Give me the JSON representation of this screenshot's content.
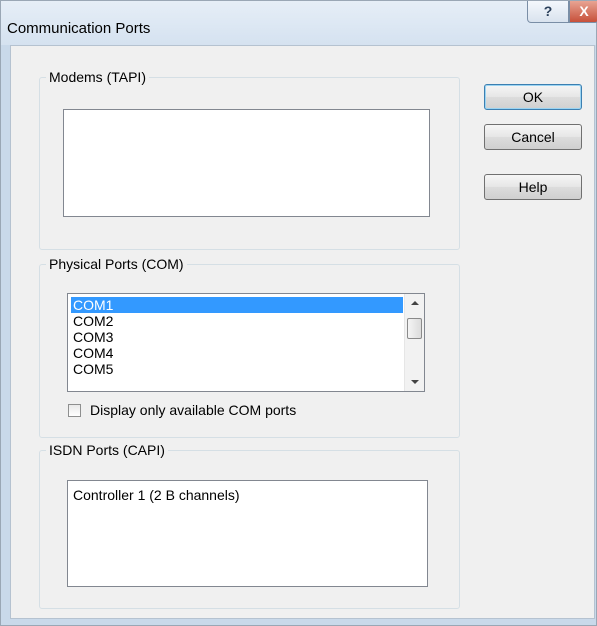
{
  "window": {
    "title": "Communication Ports",
    "help_glyph": "?",
    "close_glyph": "X"
  },
  "modems": {
    "legend": "Modems (TAPI)"
  },
  "physical": {
    "legend": "Physical Ports (COM)",
    "ports": [
      "COM1",
      "COM2",
      "COM3",
      "COM4",
      "COM5"
    ],
    "selected": "COM1",
    "checkbox_label": "Display only available COM ports",
    "checkbox_checked": false
  },
  "isdn": {
    "legend": "ISDN Ports (CAPI)",
    "items": [
      "Controller 1 (2 B channels)"
    ]
  },
  "buttons": {
    "ok": "OK",
    "cancel": "Cancel",
    "help": "Help"
  },
  "colors": {
    "selection": "#3399ff",
    "close_button": "#c7503a"
  }
}
